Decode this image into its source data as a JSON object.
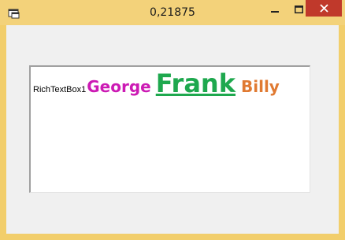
{
  "window": {
    "title": "0,21875",
    "accent_color": "#f3d27a",
    "close_color": "#c0392b"
  },
  "rich_text_box": {
    "runs": [
      {
        "text": "RichTextBox1",
        "color": "#000000",
        "bold": false,
        "underline": false
      },
      {
        "text": "George",
        "color": "#cc1ab4",
        "bold": true,
        "underline": false
      },
      {
        "text": "Frank",
        "color": "#1ea84e",
        "bold": true,
        "underline": true
      },
      {
        "text": "Billy",
        "color": "#e07a32",
        "bold": true,
        "underline": false
      }
    ]
  },
  "icons": {
    "app": "application-icon",
    "minimize": "minimize-icon",
    "maximize": "maximize-icon",
    "close": "close-icon"
  }
}
